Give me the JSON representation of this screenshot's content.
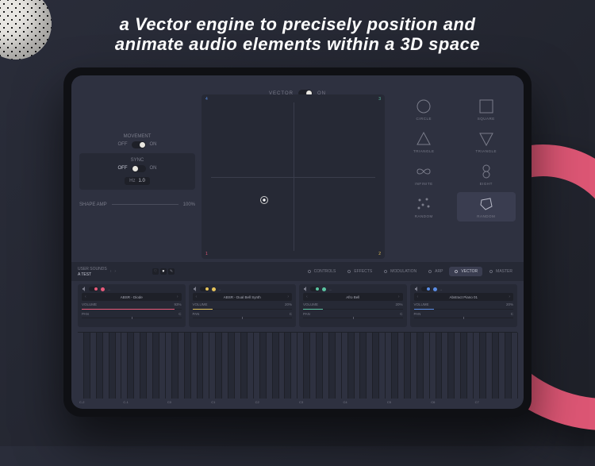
{
  "headline_l1": "a Vector engine to precisely position and",
  "headline_l2": "animate audio elements within a 3D space",
  "vector": {
    "label": "VECTOR",
    "state": "ON"
  },
  "movement": {
    "label": "MOVEMENT",
    "off": "OFF",
    "on": "ON"
  },
  "sync": {
    "label": "SYNC",
    "off": "OFF",
    "on": "ON",
    "hz_label": "Hz",
    "hz_value": "1.0"
  },
  "shape_amp": {
    "label": "SHAPE AMP",
    "value": "100%"
  },
  "pad_corners": {
    "tl": "4",
    "tr": "3",
    "bl": "1",
    "br": "2"
  },
  "shapes": [
    {
      "id": "circle",
      "label": "CIRCLE"
    },
    {
      "id": "square",
      "label": "SQUARE"
    },
    {
      "id": "tri-up",
      "label": "TRIANGLE"
    },
    {
      "id": "tri-down",
      "label": "TRIANGLE"
    },
    {
      "id": "infinite",
      "label": "INFINITE"
    },
    {
      "id": "eight",
      "label": "EIGHT"
    },
    {
      "id": "random-dots",
      "label": "RANDOM"
    },
    {
      "id": "random-poly",
      "label": "RANDOM"
    }
  ],
  "nav": {
    "user_sounds": "USER SOUNDS",
    "preset": "A TEST",
    "tabs": [
      "CONTROLS",
      "EFFECTS",
      "MODULATION",
      "ARP",
      "VECTOR",
      "MASTER"
    ]
  },
  "channels": [
    {
      "name": "ABSR - Diode",
      "color": "#e85a7a",
      "volume_label": "VOLUME",
      "volume": "93%",
      "pan_label": "PAN",
      "pan": "C",
      "on": true
    },
    {
      "name": "ABSR - Dual Bell Synth",
      "color": "#e6c35a",
      "volume_label": "VOLUME",
      "volume": "20%",
      "pan_label": "PAN",
      "pan": "C",
      "on": true
    },
    {
      "name": "Afro Bell",
      "color": "#5ac3a0",
      "volume_label": "VOLUME",
      "volume": "20%",
      "pan_label": "PAN",
      "pan": "C",
      "on": true
    },
    {
      "name": "Abstract Piano 01",
      "color": "#5a8de6",
      "volume_label": "VOLUME",
      "volume": "20%",
      "pan_label": "PAN",
      "pan": "C",
      "on": true
    }
  ],
  "octaves": [
    "C-2",
    "C-1",
    "C0",
    "C1",
    "C2",
    "C3",
    "C4",
    "C5",
    "C6",
    "C7"
  ]
}
